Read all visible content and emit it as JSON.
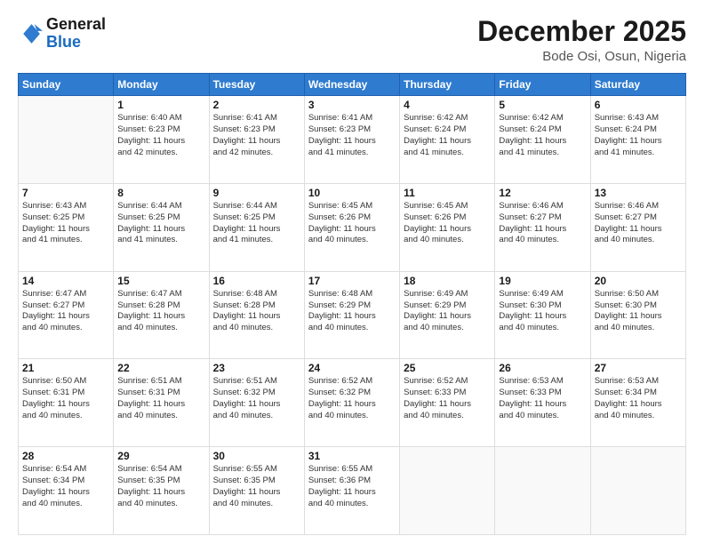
{
  "header": {
    "logo_general": "General",
    "logo_blue": "Blue",
    "main_title": "December 2025",
    "subtitle": "Bode Osi, Osun, Nigeria"
  },
  "days_of_week": [
    "Sunday",
    "Monday",
    "Tuesday",
    "Wednesday",
    "Thursday",
    "Friday",
    "Saturday"
  ],
  "weeks": [
    [
      {
        "day": "",
        "info": ""
      },
      {
        "day": "1",
        "info": "Sunrise: 6:40 AM\nSunset: 6:23 PM\nDaylight: 11 hours\nand 42 minutes."
      },
      {
        "day": "2",
        "info": "Sunrise: 6:41 AM\nSunset: 6:23 PM\nDaylight: 11 hours\nand 42 minutes."
      },
      {
        "day": "3",
        "info": "Sunrise: 6:41 AM\nSunset: 6:23 PM\nDaylight: 11 hours\nand 41 minutes."
      },
      {
        "day": "4",
        "info": "Sunrise: 6:42 AM\nSunset: 6:24 PM\nDaylight: 11 hours\nand 41 minutes."
      },
      {
        "day": "5",
        "info": "Sunrise: 6:42 AM\nSunset: 6:24 PM\nDaylight: 11 hours\nand 41 minutes."
      },
      {
        "day": "6",
        "info": "Sunrise: 6:43 AM\nSunset: 6:24 PM\nDaylight: 11 hours\nand 41 minutes."
      }
    ],
    [
      {
        "day": "7",
        "info": "Sunrise: 6:43 AM\nSunset: 6:25 PM\nDaylight: 11 hours\nand 41 minutes."
      },
      {
        "day": "8",
        "info": "Sunrise: 6:44 AM\nSunset: 6:25 PM\nDaylight: 11 hours\nand 41 minutes."
      },
      {
        "day": "9",
        "info": "Sunrise: 6:44 AM\nSunset: 6:25 PM\nDaylight: 11 hours\nand 41 minutes."
      },
      {
        "day": "10",
        "info": "Sunrise: 6:45 AM\nSunset: 6:26 PM\nDaylight: 11 hours\nand 40 minutes."
      },
      {
        "day": "11",
        "info": "Sunrise: 6:45 AM\nSunset: 6:26 PM\nDaylight: 11 hours\nand 40 minutes."
      },
      {
        "day": "12",
        "info": "Sunrise: 6:46 AM\nSunset: 6:27 PM\nDaylight: 11 hours\nand 40 minutes."
      },
      {
        "day": "13",
        "info": "Sunrise: 6:46 AM\nSunset: 6:27 PM\nDaylight: 11 hours\nand 40 minutes."
      }
    ],
    [
      {
        "day": "14",
        "info": "Sunrise: 6:47 AM\nSunset: 6:27 PM\nDaylight: 11 hours\nand 40 minutes."
      },
      {
        "day": "15",
        "info": "Sunrise: 6:47 AM\nSunset: 6:28 PM\nDaylight: 11 hours\nand 40 minutes."
      },
      {
        "day": "16",
        "info": "Sunrise: 6:48 AM\nSunset: 6:28 PM\nDaylight: 11 hours\nand 40 minutes."
      },
      {
        "day": "17",
        "info": "Sunrise: 6:48 AM\nSunset: 6:29 PM\nDaylight: 11 hours\nand 40 minutes."
      },
      {
        "day": "18",
        "info": "Sunrise: 6:49 AM\nSunset: 6:29 PM\nDaylight: 11 hours\nand 40 minutes."
      },
      {
        "day": "19",
        "info": "Sunrise: 6:49 AM\nSunset: 6:30 PM\nDaylight: 11 hours\nand 40 minutes."
      },
      {
        "day": "20",
        "info": "Sunrise: 6:50 AM\nSunset: 6:30 PM\nDaylight: 11 hours\nand 40 minutes."
      }
    ],
    [
      {
        "day": "21",
        "info": "Sunrise: 6:50 AM\nSunset: 6:31 PM\nDaylight: 11 hours\nand 40 minutes."
      },
      {
        "day": "22",
        "info": "Sunrise: 6:51 AM\nSunset: 6:31 PM\nDaylight: 11 hours\nand 40 minutes."
      },
      {
        "day": "23",
        "info": "Sunrise: 6:51 AM\nSunset: 6:32 PM\nDaylight: 11 hours\nand 40 minutes."
      },
      {
        "day": "24",
        "info": "Sunrise: 6:52 AM\nSunset: 6:32 PM\nDaylight: 11 hours\nand 40 minutes."
      },
      {
        "day": "25",
        "info": "Sunrise: 6:52 AM\nSunset: 6:33 PM\nDaylight: 11 hours\nand 40 minutes."
      },
      {
        "day": "26",
        "info": "Sunrise: 6:53 AM\nSunset: 6:33 PM\nDaylight: 11 hours\nand 40 minutes."
      },
      {
        "day": "27",
        "info": "Sunrise: 6:53 AM\nSunset: 6:34 PM\nDaylight: 11 hours\nand 40 minutes."
      }
    ],
    [
      {
        "day": "28",
        "info": "Sunrise: 6:54 AM\nSunset: 6:34 PM\nDaylight: 11 hours\nand 40 minutes."
      },
      {
        "day": "29",
        "info": "Sunrise: 6:54 AM\nSunset: 6:35 PM\nDaylight: 11 hours\nand 40 minutes."
      },
      {
        "day": "30",
        "info": "Sunrise: 6:55 AM\nSunset: 6:35 PM\nDaylight: 11 hours\nand 40 minutes."
      },
      {
        "day": "31",
        "info": "Sunrise: 6:55 AM\nSunset: 6:36 PM\nDaylight: 11 hours\nand 40 minutes."
      },
      {
        "day": "",
        "info": ""
      },
      {
        "day": "",
        "info": ""
      },
      {
        "day": "",
        "info": ""
      }
    ]
  ]
}
